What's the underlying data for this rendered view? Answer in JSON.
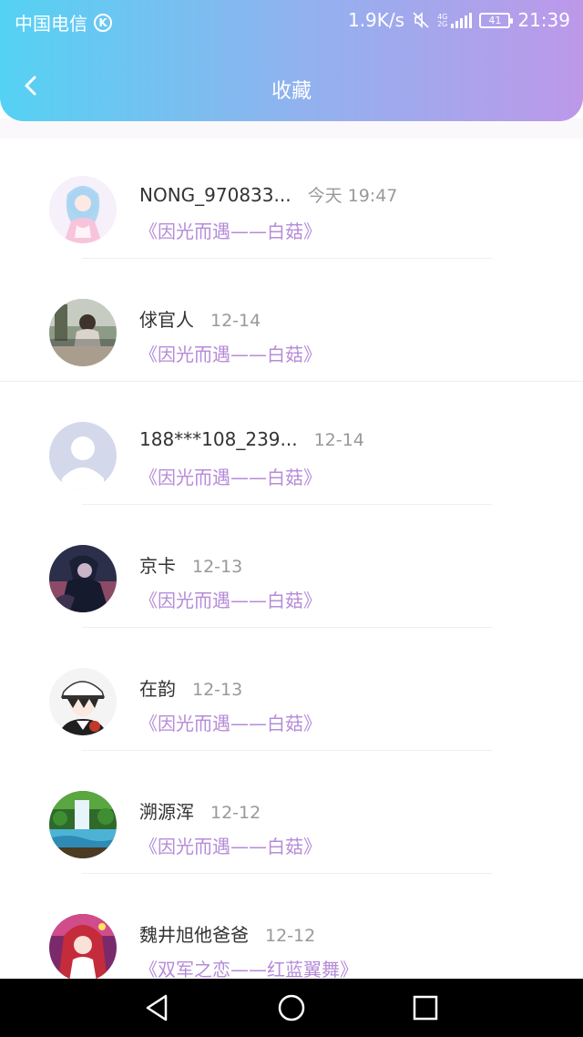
{
  "status_bar": {
    "carrier": "中国电信",
    "carrier_badge": "K",
    "speed": "1.9K/s",
    "network_tag_top": "4G",
    "network_tag_bottom": "2G",
    "battery": "41",
    "time": "21:39"
  },
  "nav": {
    "title": "收藏",
    "back_icon": "chevron-left-icon"
  },
  "favorites": [
    {
      "name": "NONG_970833...",
      "time": "今天 19:47",
      "title": "《因光而遇——白菇》",
      "avatar": "anime-girl-avatar"
    },
    {
      "name": "俅官人",
      "time": "12-14",
      "title": "《因光而遇——白菇》",
      "avatar": "photo-avatar"
    },
    {
      "name": "188***108_239...",
      "time": "12-14",
      "title": "《因光而遇——白菇》",
      "avatar": "default-user-avatar"
    },
    {
      "name": "京卡",
      "time": "12-13",
      "title": "《因光而遇——白菇》",
      "avatar": "dark-anime-avatar"
    },
    {
      "name": "在韵",
      "time": "12-13",
      "title": "《因光而遇——白菇》",
      "avatar": "anime-boy-avatar"
    },
    {
      "name": "溯源浑",
      "time": "12-12",
      "title": "《因光而遇——白菇》",
      "avatar": "waterfall-avatar"
    },
    {
      "name": "魏井旭他爸爸",
      "time": "12-12",
      "title": "《双军之恋——红蓝翼舞》",
      "avatar": "red-hair-anime-avatar"
    }
  ],
  "system_nav": {
    "back": "back-triangle-icon",
    "home": "home-circle-icon",
    "recents": "recents-square-icon"
  },
  "colors": {
    "header_gradient_start": "#54d2f3",
    "header_gradient_end": "#bd98e9",
    "title_purple": "#b68bd8",
    "time_gray": "#999999"
  }
}
